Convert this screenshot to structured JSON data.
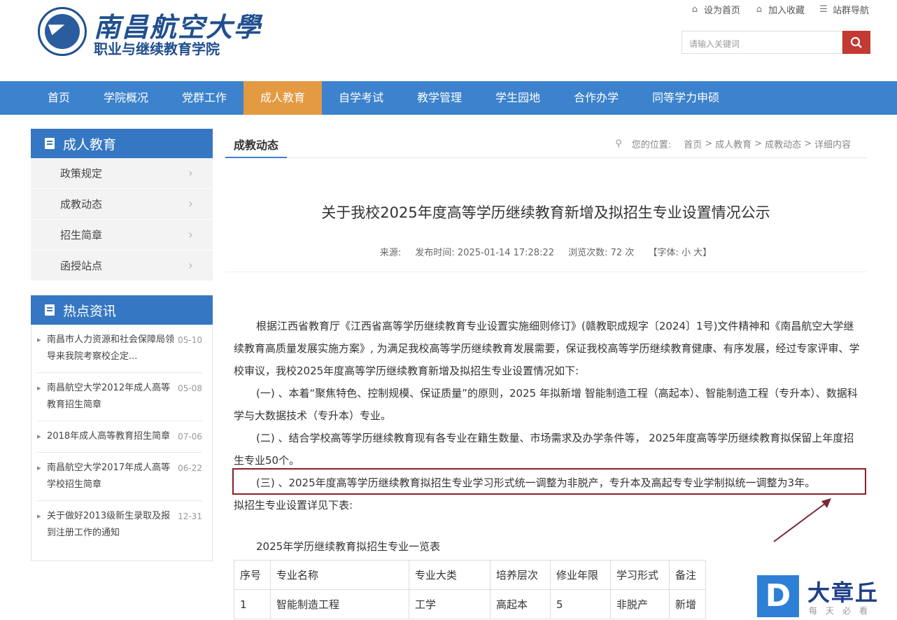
{
  "header": {
    "logo_title": "南昌航空大學",
    "logo_subtitle": "职业与继续教育学院",
    "links": [
      "设为首页",
      "加入收藏",
      "站群导航"
    ],
    "search_placeholder": "请输入关键词"
  },
  "nav": [
    "首页",
    "学院概况",
    "党群工作",
    "成人教育",
    "自学考试",
    "教学管理",
    "学生园地",
    "合作办学",
    "同等学力申硕"
  ],
  "sidebar": {
    "section_title": "成人教育",
    "menu": [
      "政策规定",
      "成教动态",
      "招生简章",
      "函授站点"
    ],
    "hot_title": "热点资讯",
    "hot": [
      {
        "text": "南昌市人力资源和社会保障局领导来我院考察校企定...",
        "date": "05-10"
      },
      {
        "text": "南昌航空大学2012年成人高等教育招生简章",
        "date": "05-08"
      },
      {
        "text": "2018年成人高等教育招生简章",
        "date": "07-06"
      },
      {
        "text": "南昌航空大学2017年成人高等学校招生简章",
        "date": "06-22"
      },
      {
        "text": "关于做好2013级新生录取及报到注册工作的通知",
        "date": "12-31"
      }
    ]
  },
  "main": {
    "tab": "成教动态",
    "crumb": [
      "您的位置:",
      "首页",
      ">",
      "成人教育",
      ">",
      "成教动态",
      ">",
      "详细内容"
    ],
    "title": "关于我校2025年度高等学历继续教育新增及拟招生专业设置情况公示",
    "meta": {
      "source": "来源:",
      "time": "发布时间: 2025-01-14 17:28:22",
      "views": "浏览次数: 72 次",
      "font": "【字体: 小 大】"
    },
    "paragraphs": [
      "根据江西省教育厅《江西省高等学历继续教育专业设置实施细则修订》(赣教职成规字〔2024〕1号)文件精神和《南昌航空大学继续教育高质量发展实施方案》, 为满足我校高等学历继续教育发展需要，保证我校高等学历继续教育健康、有序发展，经过专家评审、学校审议，我校2025年度高等学历继续教育新增及拟招生专业设置情况如下:",
      "(一) 、本着“聚焦特色、控制规模、保证质量”的原则，2025 年拟新增 智能制造工程（高起本）、智能制造工程（专升本）、数据科学与大数据技术（专升本）专业。",
      "(二) 、结合学校高等学历继续教育现有各专业在籍生数量、市场需求及办学条件等， 2025年度高等学历继续教育拟保留上年度招生专业50个。",
      "(三) 、2025年度高等学历继续教育拟招生专业学习形式统一调整为非脱产，专升本及高起专专业学制拟统一调整为3年。"
    ],
    "after_text": "拟招生专业设置详见下表:",
    "table_caption": "2025年学历继续教育拟招生专业一览表",
    "table_headers": [
      "序号",
      "专业名称",
      "专业大类",
      "培养层次",
      "修业年限",
      "学习形式",
      "备注"
    ],
    "table_rows": [
      [
        "1",
        "智能制造工程",
        "工学",
        "高起本",
        "5",
        "非脱产",
        "新增"
      ]
    ]
  },
  "watermark": {
    "logo": "D",
    "title": "大章丘",
    "slogan": "每天必看"
  },
  "colors": {
    "nav": "#3c82cc",
    "nav_active": "#e39a43",
    "highlight": "#8b1e2a",
    "search_btn": "#c23a32"
  }
}
